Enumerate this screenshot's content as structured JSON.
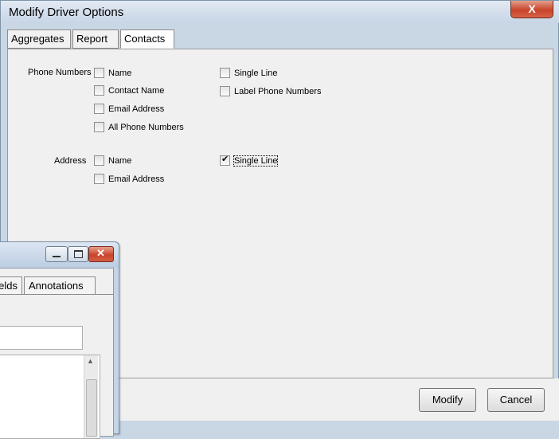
{
  "dialog": {
    "title": "Modify Driver Options",
    "close_label": "X",
    "tabs": [
      {
        "label": "Aggregates",
        "active": false
      },
      {
        "label": "Report",
        "active": false
      },
      {
        "label": "Contacts",
        "active": true
      }
    ],
    "phone_numbers": {
      "label": "Phone Numbers",
      "options": [
        {
          "label": "Name",
          "checked": false
        },
        {
          "label": "Contact Name",
          "checked": false
        },
        {
          "label": "Email Address",
          "checked": false
        },
        {
          "label": "All Phone Numbers",
          "checked": false
        },
        {
          "label": "Single Line",
          "checked": false
        },
        {
          "label": "Label Phone Numbers",
          "checked": false
        }
      ]
    },
    "address": {
      "label": "Address",
      "options": [
        {
          "label": "Name",
          "checked": false
        },
        {
          "label": "Email Address",
          "checked": false
        },
        {
          "label": "Single Line",
          "checked": true
        }
      ]
    },
    "buttons": {
      "modify": "Modify",
      "cancel": "Cancel"
    }
  },
  "background_window": {
    "tabs": [
      {
        "label": "Fields"
      },
      {
        "label": "Annotations"
      }
    ]
  }
}
